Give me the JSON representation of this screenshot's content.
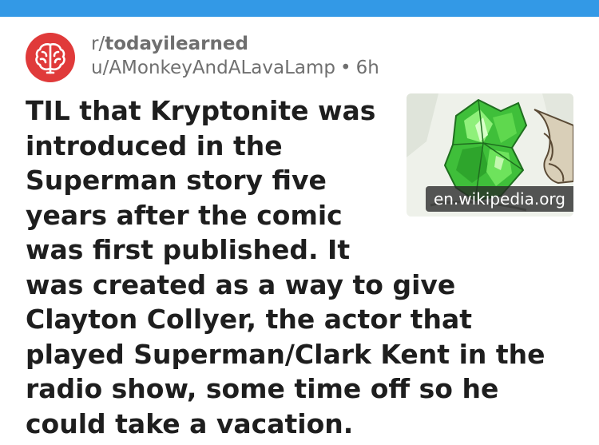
{
  "post": {
    "subreddit_prefix": "r/",
    "subreddit_name": "todayilearned",
    "author": "u/AMonkeyAndALavaLamp",
    "separator": "•",
    "age": "6h",
    "title": "TIL that Kryptonite was introduced in the Superman story five years after the comic was first published. It was created as a way to give Clayton Collyer, the actor that played Superman/Clark Kent in the radio show, some time off so he could take a vacation.",
    "link_domain": "en.wikipedia.org"
  },
  "colors": {
    "topbar": "#3399e6",
    "avatar": "#e03a3a",
    "meta_text": "#6f6f6f",
    "title_text": "#1e1e1e"
  },
  "icons": {
    "avatar": "brain-icon"
  }
}
